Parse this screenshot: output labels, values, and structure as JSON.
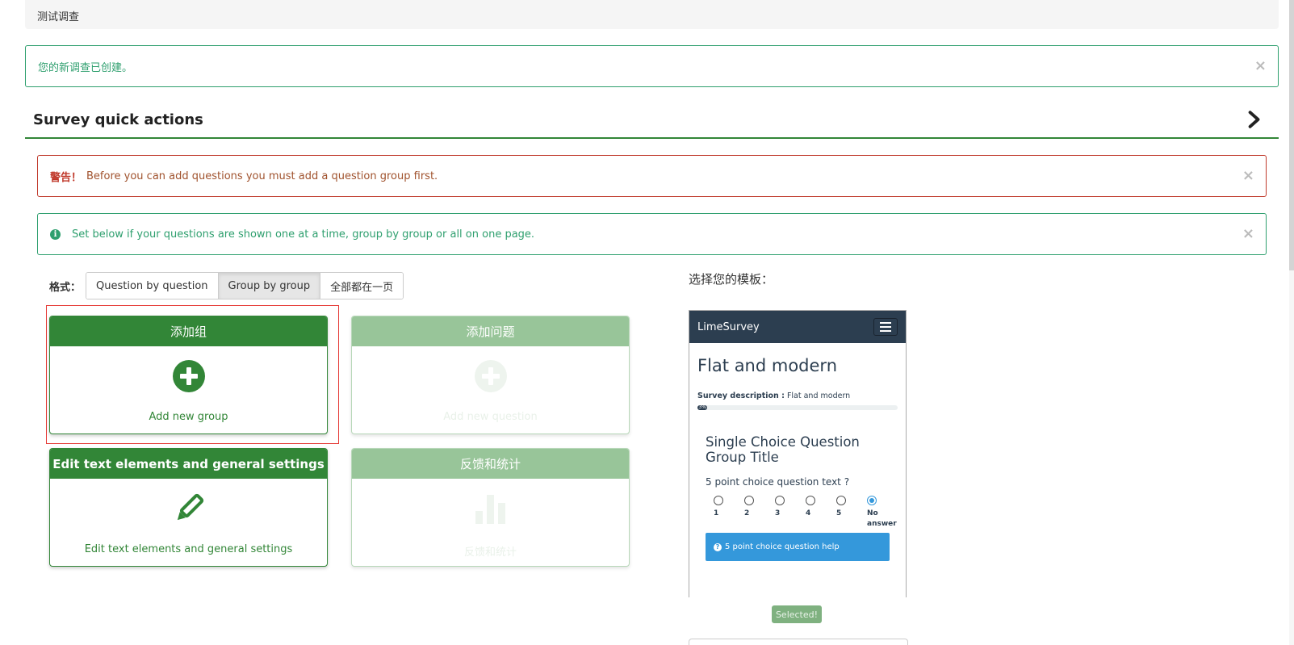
{
  "breadcrumb": {
    "survey_name": "测试调查"
  },
  "alerts": {
    "success": {
      "text": "您的新调查已创建。",
      "close": "×"
    },
    "warning": {
      "prefix": "警告！",
      "text": "Before you can add questions you must add a question group first.",
      "close": "×"
    },
    "info": {
      "icon": "i",
      "text": "Set below if your questions are shown one at a time, group by group or all on one page.",
      "close": "×"
    }
  },
  "quick_actions": {
    "title": "Survey quick actions",
    "toggle_icon": "chevron-right-icon"
  },
  "format": {
    "label": "格式：",
    "options": [
      "Question by question",
      "Group by group",
      "全部都在一页"
    ],
    "selected": "Group by group"
  },
  "cards": {
    "add_group": {
      "header": "添加组",
      "text": "Add new group",
      "icon": "plus-circle-icon"
    },
    "add_question": {
      "header": "添加问题",
      "text": "Add new question",
      "icon": "plus-circle-icon"
    },
    "edit_text": {
      "header": "Edit text elements and general settings",
      "text": "Edit text elements and general settings",
      "icon": "pencil-icon"
    },
    "stats": {
      "header": "反馈和统计",
      "text": "反馈和统计",
      "icon": "bar-chart-icon"
    }
  },
  "template": {
    "title": "选择您的模板：",
    "brand": "LimeSurvey",
    "survey_title": "Flat and modern",
    "desc_label": "Survey description :",
    "desc_value": "Flat and modern",
    "progress_label": "3%",
    "progress": 0.05,
    "group_title": "Single Choice Question Group Title",
    "question": "5 point choice question text ?",
    "choices": [
      "1",
      "2",
      "3",
      "4",
      "5",
      "No answer"
    ],
    "checked_choice": "No answer",
    "help": "5 point choice question help",
    "selected_label": "Selected!"
  },
  "colors": {
    "brand_green": "#328637",
    "disabled_green": "#98c599",
    "navy": "#2c3e50",
    "info_blue": "#3498db"
  }
}
